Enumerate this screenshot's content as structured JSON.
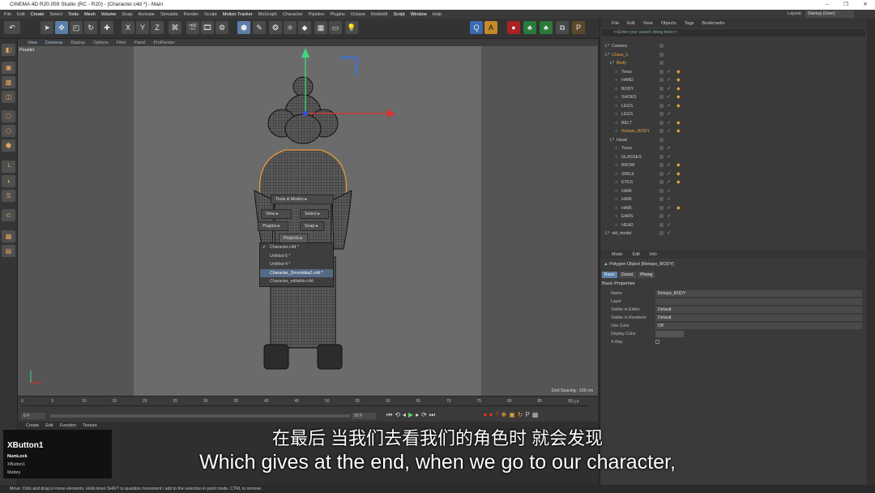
{
  "window": {
    "title": "CINEMA 4D R20.059 Studio (RC - R20) - [Character.c4d *] - Main",
    "controls": [
      "–",
      "❐",
      "✕"
    ]
  },
  "menubar": {
    "items": [
      "File",
      "Edit",
      "Create",
      "Select",
      "Tools",
      "Mesh",
      "Volume",
      "Snap",
      "Animate",
      "Simulate",
      "Render",
      "Sculpt",
      "Motion Tracker",
      "MoGraph",
      "Character",
      "Pipeline",
      "Plugins",
      "Octane",
      "Redshift",
      "Script",
      "Window",
      "Help"
    ]
  },
  "layout": {
    "label": "Layout:",
    "value": "Startup (User)"
  },
  "toolbar": {
    "axes": [
      "X",
      "Y",
      "Z"
    ]
  },
  "viewport": {
    "menu": [
      "View",
      "Cameras",
      "Display",
      "Options",
      "Filter",
      "Panel",
      "ProRender"
    ],
    "projection": "Parallel",
    "grid_spacing": "Grid Spacing : 100 cm"
  },
  "context_menu": {
    "tools_modes": "Tools & Modes ▸",
    "view": "View ▸",
    "select": "Select ▸",
    "plugins": "Plugins ▸",
    "snap": "Snap ▸",
    "projects": "Projects ▸",
    "project_items": [
      "Character.c4d *",
      "Untitled 5 *",
      "Untitled 4 *",
      "Character_Dmoretika2.c4d *",
      "Character_editable.c4d"
    ],
    "checked_index": 0,
    "hover_index": 3
  },
  "timeline": {
    "ticks": [
      "0",
      "5",
      "10",
      "15",
      "20",
      "25",
      "30",
      "35",
      "40",
      "45",
      "50",
      "55",
      "60",
      "65",
      "70",
      "75",
      "80",
      "85",
      "90"
    ],
    "start_frame": "0 F",
    "end_frame": "90 F",
    "current": "0 F",
    "end_label": "-1 F"
  },
  "materials": {
    "menu": [
      "Create",
      "Edit",
      "Function",
      "Texture"
    ]
  },
  "object_manager": {
    "menu": [
      "File",
      "Edit",
      "View",
      "Objects",
      "Tags",
      "Bookmarks"
    ],
    "search_placeholder": "<<Enter your search string here>>",
    "rows": [
      {
        "name": "Camera",
        "indent": 0,
        "color": "#c8c8c8"
      },
      {
        "name": "Chara_1",
        "indent": 0,
        "color": "#e8a040"
      },
      {
        "name": "Body",
        "indent": 1,
        "color": "#e8a040"
      },
      {
        "name": "Torus",
        "indent": 2,
        "color": "#c8c8c8"
      },
      {
        "name": "HAND",
        "indent": 2,
        "color": "#c8c8c8"
      },
      {
        "name": "BODY",
        "indent": 2,
        "color": "#c8c8c8"
      },
      {
        "name": "SHOES",
        "indent": 2,
        "color": "#c8c8c8"
      },
      {
        "name": "LEGS",
        "indent": 2,
        "color": "#c8c8c8"
      },
      {
        "name": "LEGS",
        "indent": 2,
        "color": "#c8c8c8"
      },
      {
        "name": "BELT",
        "indent": 2,
        "color": "#c8c8c8"
      },
      {
        "name": "Retopo_BODY",
        "indent": 2,
        "color": "#e8a040"
      },
      {
        "name": "Head",
        "indent": 1,
        "color": "#c8c8c8"
      },
      {
        "name": "Torus",
        "indent": 2,
        "color": "#c8c8c8"
      },
      {
        "name": "GLASSES",
        "indent": 2,
        "color": "#c8c8c8"
      },
      {
        "name": "BROW",
        "indent": 2,
        "color": "#c8c8c8"
      },
      {
        "name": "SMILE",
        "indent": 2,
        "color": "#c8c8c8"
      },
      {
        "name": "EYES",
        "indent": 2,
        "color": "#c8c8c8"
      },
      {
        "name": "HAIR",
        "indent": 2,
        "color": "#c8c8c8"
      },
      {
        "name": "HAIR",
        "indent": 2,
        "color": "#c8c8c8"
      },
      {
        "name": "HAIR",
        "indent": 2,
        "color": "#c8c8c8"
      },
      {
        "name": "EARS",
        "indent": 2,
        "color": "#c8c8c8"
      },
      {
        "name": "HEAD",
        "indent": 2,
        "color": "#c8c8c8"
      },
      {
        "name": "old_model",
        "indent": 0,
        "color": "#c8c8c8"
      }
    ]
  },
  "attribute_manager": {
    "menu": [
      "Mode",
      "Edit",
      "Info"
    ],
    "title": "Polygon Object [Retopo_BODY]",
    "tabs": [
      "Basic",
      "Coord.",
      "Phong"
    ],
    "section": "Basic Properties",
    "fields": [
      {
        "label": "Name",
        "value": "Retopo_BODY"
      },
      {
        "label": "Layer",
        "value": ""
      },
      {
        "label": "Visible in Editor",
        "value": "Default"
      },
      {
        "label": "Visible in Renderer",
        "value": "Default"
      },
      {
        "label": "Use Color",
        "value": "Off"
      },
      {
        "label": "Display Color",
        "value": ""
      },
      {
        "label": "X-Ray",
        "value": ""
      }
    ]
  },
  "key_osd": {
    "title": "XButton1",
    "lines": [
      "NumLock",
      "XButton1",
      "Mattey"
    ]
  },
  "subtitles": {
    "cn": "在最后 当我们去看我们的角色时 就会发现",
    "en": "Which gives at the end, when we go to our character,"
  },
  "statusbar": "Move: Click and drag to move elements. Hold down SHIFT to quantize movement / add to the selection in point mode, CTRL to remove."
}
